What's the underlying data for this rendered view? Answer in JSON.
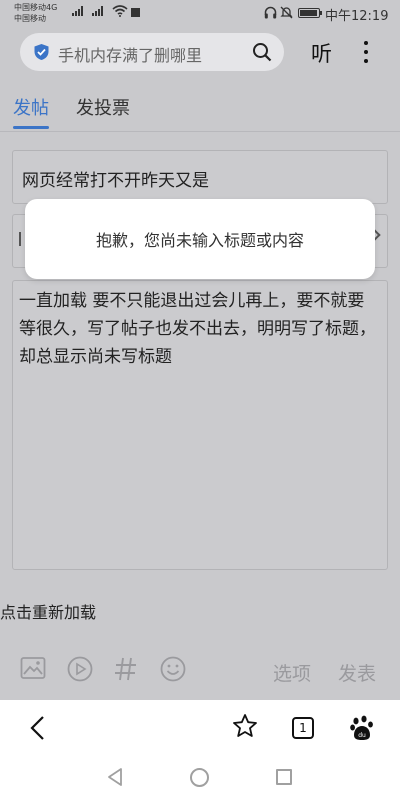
{
  "status_bar": {
    "carrier_1": "中国移动4G",
    "carrier_2": "中国移动",
    "network_tag": "4G",
    "time": "中午12:19"
  },
  "search": {
    "query": "手机内存满了删哪里",
    "listen_label": "听"
  },
  "tabs": [
    {
      "label": "发帖",
      "active": true
    },
    {
      "label": "发投票",
      "active": false
    }
  ],
  "post": {
    "title_value": "网页经常打不开昨天又是",
    "content_value": "一直加载 要不只能退出过会儿再上，要不就要等很久，写了帖子也发不出去，明明写了标题，却总显示尚未写标题"
  },
  "toast": {
    "message": "抱歉，您尚未输入标题或内容"
  },
  "reload_link": "点击重新加载",
  "toolbar": {
    "options_label": "选项",
    "publish_label": "发表",
    "icons": [
      "image-icon",
      "video-icon",
      "hashtag-icon",
      "emoji-icon"
    ]
  },
  "browser_nav": {
    "tab_count": "1",
    "icons": [
      "back-icon",
      "star-icon",
      "tabs-icon",
      "baidu-paw-icon"
    ]
  },
  "colors": {
    "accent": "#3b74c7",
    "overlay_background": "#c9c9cc",
    "toast_background": "#ffffff",
    "muted_text": "#9a9a9e"
  }
}
